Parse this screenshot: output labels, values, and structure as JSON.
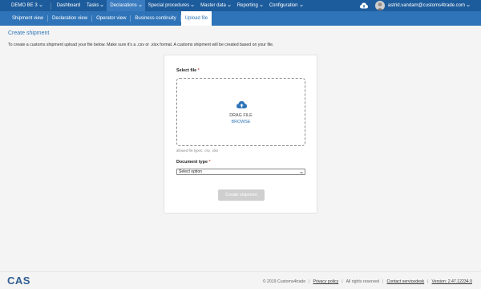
{
  "topbar": {
    "environment": "DEMO BE 3",
    "items": [
      {
        "label": "Dashboard",
        "dropdown": false,
        "active": false
      },
      {
        "label": "Tasks",
        "dropdown": true,
        "active": false
      },
      {
        "label": "Declarations",
        "dropdown": true,
        "active": true
      },
      {
        "label": "Special procedures",
        "dropdown": true,
        "active": false
      },
      {
        "label": "Master data",
        "dropdown": true,
        "active": false
      },
      {
        "label": "Reporting",
        "dropdown": true,
        "active": false
      },
      {
        "label": "Configuration",
        "dropdown": true,
        "active": false
      }
    ],
    "user": "astrid.vandam@customs4trade.com"
  },
  "subnav": {
    "items": [
      "Shipment view",
      "Declaration view",
      "Operator view",
      "Business continuity",
      "Upload file"
    ],
    "active": "Upload file"
  },
  "page": {
    "title": "Create shipment",
    "description": "To create a customs shipment upload your file below. Make sure it's a .csv or .xlsx format. A customs shipment will be created based on your file."
  },
  "form": {
    "select_file_label": "Select file",
    "required_mark": "*",
    "drag_text": "DRAG FILE",
    "browse_text": "BROWSE",
    "allowed_types": "allowed file types: .csv, .xlsx",
    "document_type_label": "Document type",
    "document_type_value": "Select option",
    "submit_label": "Create shipment"
  },
  "footer": {
    "logo": "CAS",
    "copyright": "© 2019 Customs4trade",
    "privacy": "Privacy policy",
    "rights": "All rights reserved",
    "servicedesk": "Contact servicedesk",
    "version": "Version: 2.47.12234.0"
  },
  "colors": {
    "topbar": "#1d5c9c",
    "subbar": "#2f74b8",
    "accent": "#2f74b8",
    "button_disabled": "#cfcfcf"
  },
  "icons": [
    "chevron-down-icon",
    "cloud-upload-icon",
    "avatar"
  ]
}
